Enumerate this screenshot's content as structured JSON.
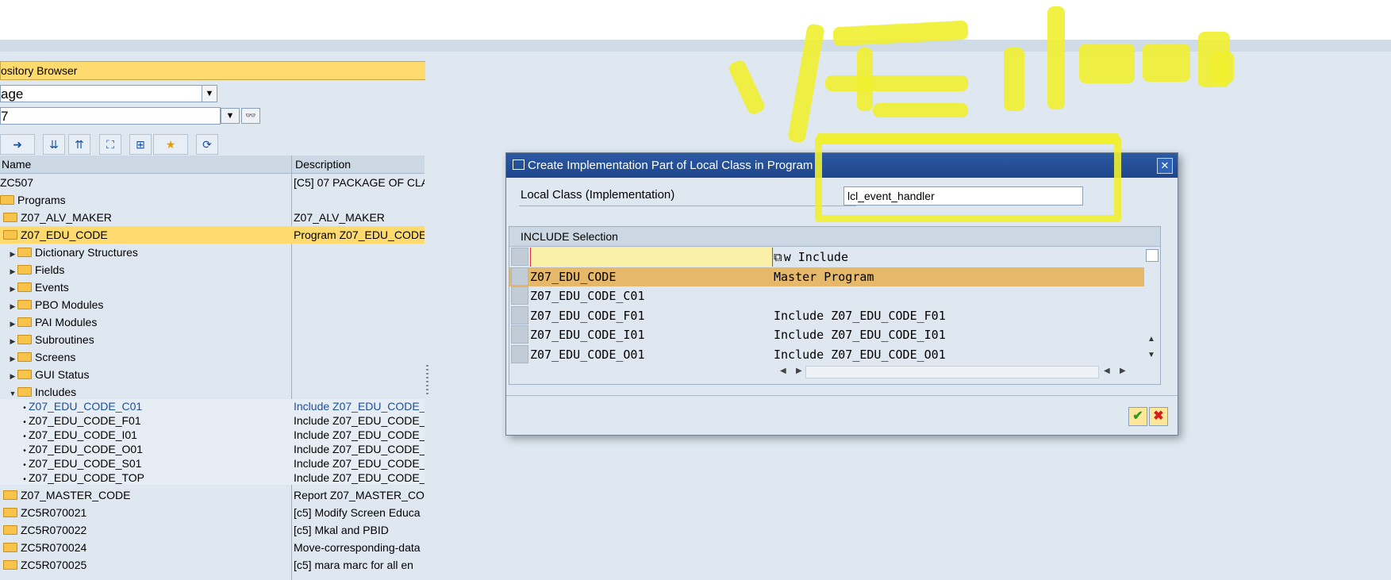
{
  "left_panel": {
    "title": "ository Browser",
    "object_type": "age",
    "object_name": "7",
    "columns": {
      "name": "Name",
      "description": "Description"
    },
    "rows": [
      {
        "indent": 0,
        "kind": "text",
        "name": "ZC507",
        "desc": "[C5] 07 PACKAGE OF CLA"
      },
      {
        "indent": 0,
        "kind": "folder-open",
        "name": "Programs",
        "desc": ""
      },
      {
        "indent": 1,
        "kind": "folder",
        "name": "Z07_ALV_MAKER",
        "desc": "Z07_ALV_MAKER"
      },
      {
        "indent": 1,
        "kind": "folder-open",
        "name": "Z07_EDU_CODE",
        "desc": "Program Z07_EDU_CODE",
        "highlight": true
      },
      {
        "indent": 2,
        "kind": "folder-arrow",
        "name": "Dictionary Structures",
        "desc": ""
      },
      {
        "indent": 2,
        "kind": "folder-arrow",
        "name": "Fields",
        "desc": ""
      },
      {
        "indent": 2,
        "kind": "folder-arrow",
        "name": "Events",
        "desc": ""
      },
      {
        "indent": 2,
        "kind": "folder-arrow",
        "name": "PBO Modules",
        "desc": ""
      },
      {
        "indent": 2,
        "kind": "folder-arrow",
        "name": "PAI Modules",
        "desc": ""
      },
      {
        "indent": 2,
        "kind": "folder-arrow",
        "name": "Subroutines",
        "desc": ""
      },
      {
        "indent": 2,
        "kind": "folder-arrow",
        "name": "Screens",
        "desc": ""
      },
      {
        "indent": 2,
        "kind": "folder-arrow",
        "name": "GUI Status",
        "desc": ""
      },
      {
        "indent": 2,
        "kind": "folder-down",
        "name": "Includes",
        "desc": ""
      },
      {
        "indent": 3,
        "kind": "bullet",
        "name": "Z07_EDU_CODE_C01",
        "desc": "Include Z07_EDU_CODE_",
        "blue": true
      },
      {
        "indent": 3,
        "kind": "bullet",
        "name": "Z07_EDU_CODE_F01",
        "desc": "Include Z07_EDU_CODE_"
      },
      {
        "indent": 3,
        "kind": "bullet",
        "name": "Z07_EDU_CODE_I01",
        "desc": "Include Z07_EDU_CODE_"
      },
      {
        "indent": 3,
        "kind": "bullet",
        "name": "Z07_EDU_CODE_O01",
        "desc": "Include Z07_EDU_CODE_"
      },
      {
        "indent": 3,
        "kind": "bullet",
        "name": "Z07_EDU_CODE_S01",
        "desc": "Include Z07_EDU_CODE_"
      },
      {
        "indent": 3,
        "kind": "bullet",
        "name": "Z07_EDU_CODE_TOP",
        "desc": "Include Z07_EDU_CODE_"
      },
      {
        "indent": 1,
        "kind": "folder",
        "name": "Z07_MASTER_CODE",
        "desc": "Report Z07_MASTER_COI"
      },
      {
        "indent": 1,
        "kind": "folder",
        "name": "ZC5R070021",
        "desc": "[c5] Modify Screen Educa"
      },
      {
        "indent": 1,
        "kind": "folder",
        "name": "ZC5R070022",
        "desc": "[c5] Mkal and PBID"
      },
      {
        "indent": 1,
        "kind": "folder",
        "name": "ZC5R070024",
        "desc": "Move-corresponding-data"
      },
      {
        "indent": 1,
        "kind": "folder",
        "name": "ZC5R070025",
        "desc": "[c5] mara marc for all en"
      }
    ]
  },
  "dialog": {
    "title": "Create Implementation Part of Local Class in Program",
    "field_label": "Local Class (Implementation)",
    "field_value": "lcl_event_handler",
    "grid_title": "INCLUDE Selection",
    "rows": [
      {
        "c1": "",
        "c2": "w Include",
        "state": "input"
      },
      {
        "c1": "Z07_EDU_CODE",
        "c2": "Master Program",
        "state": "selected"
      },
      {
        "c1": "Z07_EDU_CODE_C01",
        "c2": "",
        "state": "normal"
      },
      {
        "c1": "Z07_EDU_CODE_F01",
        "c2": "Include Z07_EDU_CODE_F01",
        "state": "normal"
      },
      {
        "c1": "Z07_EDU_CODE_I01",
        "c2": "Include Z07_EDU_CODE_I01",
        "state": "normal"
      },
      {
        "c1": "Z07_EDU_CODE_O01",
        "c2": "Include Z07_EDU_CODE_O01",
        "state": "normal"
      }
    ]
  },
  "colors": {
    "selected_row": "#e6b86a",
    "title_bar": "#1d458b",
    "highlighter": "#f0ef2f"
  }
}
